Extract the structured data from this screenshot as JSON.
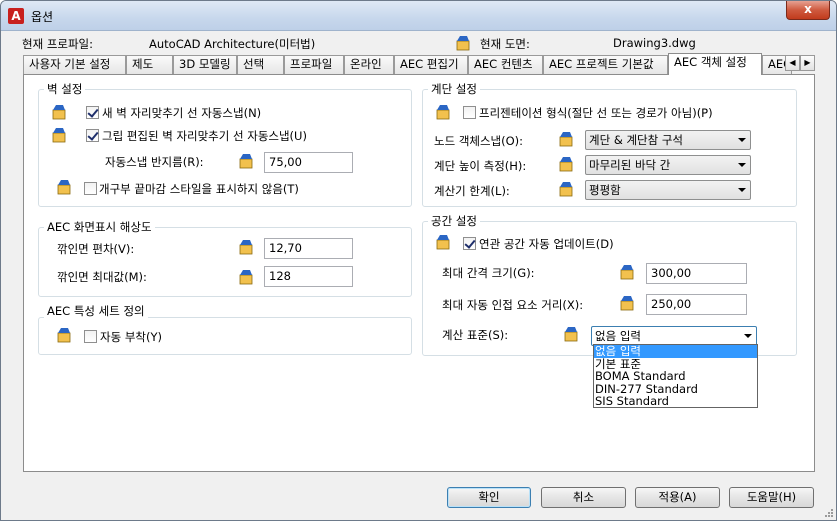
{
  "window": {
    "title": "옵션",
    "close_glyph": "x"
  },
  "profile": {
    "label": "현재 프로파일:",
    "value": "AutoCAD Architecture(미터법)",
    "drawing_label": "현재 도면:",
    "drawing_value": "Drawing3.dwg"
  },
  "tabs": [
    {
      "label": "사용자 기본 설정"
    },
    {
      "label": "제도"
    },
    {
      "label": "3D 모델링"
    },
    {
      "label": "선택"
    },
    {
      "label": "프로파일"
    },
    {
      "label": "온라인"
    },
    {
      "label": "AEC 편집기"
    },
    {
      "label": "AEC 컨텐츠"
    },
    {
      "label": "AEC 프로젝트 기본값"
    },
    {
      "label": "AEC 객체 설정"
    },
    {
      "label": "AEC"
    }
  ],
  "wall": {
    "title": "벽 설정",
    "auto_snap": {
      "label": "새 벽 자리맞추기 선 자동스냅(N)",
      "checked": true
    },
    "grip_snap": {
      "label": "그립 편집된 벽 자리맞추기 선 자동스냅(U)",
      "checked": true
    },
    "radius_label": "자동스냅 반지름(R):",
    "radius_value": "75,00",
    "opening": {
      "label": "개구부 끝마감 스타일을 표시하지 않음(T)",
      "checked": false
    }
  },
  "resolution": {
    "title": "AEC 화면표시 해상도",
    "dev_label": "깎인면 편차(V):",
    "dev_value": "12,70",
    "max_label": "깎인면 최대값(M):",
    "max_value": "128"
  },
  "propset": {
    "title": "AEC 특성 세트 정의",
    "auto_attach": {
      "label": "자동 부착(Y)",
      "checked": false
    }
  },
  "stair": {
    "title": "계단 설정",
    "presentation": {
      "label": "프리젠테이션 형식(절단 선 또는 경로가 아님)(P)",
      "checked": false
    },
    "node_label": "노드 객체스냅(O):",
    "node_value": "계단 & 계단참 구석",
    "height_label": "계단 높이 측정(H):",
    "height_value": "마무리된 바닥 간",
    "limit_label": "계산기 한계(L):",
    "limit_value": "평평함"
  },
  "space": {
    "title": "공간 설정",
    "auto_update": {
      "label": "연관 공간 자동 업데이트(D)",
      "checked": true
    },
    "gap_label": "최대 간격 크기(G):",
    "gap_value": "300,00",
    "dist_label": "최대 자동 인접 요소 거리(X):",
    "dist_value": "250,00",
    "standard_label": "계산 표준(S):",
    "standard_value": "없음 입력",
    "standard_options": [
      "없음 입력",
      "기본 표준",
      "BOMA Standard",
      "DIN-277 Standard",
      "SIS Standard"
    ]
  },
  "buttons": {
    "ok": "확인",
    "cancel": "취소",
    "apply": "적용(A)",
    "help": "도움말(H)"
  },
  "colors": {
    "accent": "#3399ff",
    "titlebar": "#c7d7ec",
    "close": "#c13b1d",
    "group_border": "#d5dfe5"
  }
}
